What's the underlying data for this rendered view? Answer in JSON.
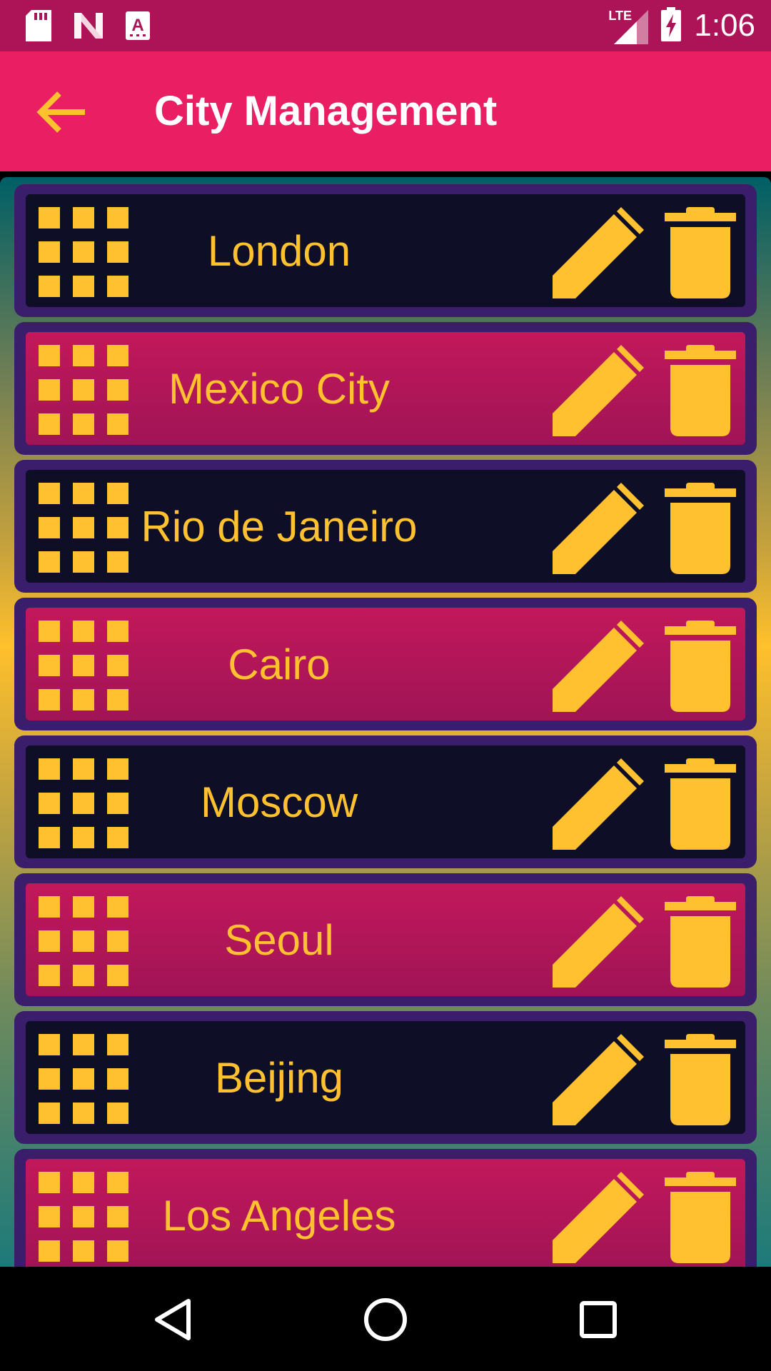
{
  "status_bar": {
    "time": "1:06",
    "network": "LTE",
    "icons": [
      "sd-card-icon",
      "n-icon",
      "text-a-icon",
      "lte-signal-icon",
      "battery-charging-icon"
    ]
  },
  "app_bar": {
    "title": "City Management",
    "back_icon": "arrow-back-icon"
  },
  "colors": {
    "accent": "#FFC130",
    "app_bar": "#E91E63",
    "status_bar": "#AD1457",
    "card_dark": "#0E0F26",
    "card_pink": "#C2185B",
    "card_border": "#3A1E6C"
  },
  "cities": [
    {
      "name": "London",
      "style": "dark"
    },
    {
      "name": "Mexico City",
      "style": "pink"
    },
    {
      "name": "Rio de Janeiro",
      "style": "dark"
    },
    {
      "name": "Cairo",
      "style": "pink"
    },
    {
      "name": "Moscow",
      "style": "dark"
    },
    {
      "name": "Seoul",
      "style": "pink"
    },
    {
      "name": "Beijing",
      "style": "dark"
    },
    {
      "name": "Los Angeles",
      "style": "pink"
    }
  ],
  "row_icons": {
    "handle": "drag-grid-icon",
    "edit": "pencil-icon",
    "delete": "trash-icon"
  },
  "nav_bar": {
    "icons": [
      "back-triangle-icon",
      "home-circle-icon",
      "recents-square-icon"
    ]
  }
}
